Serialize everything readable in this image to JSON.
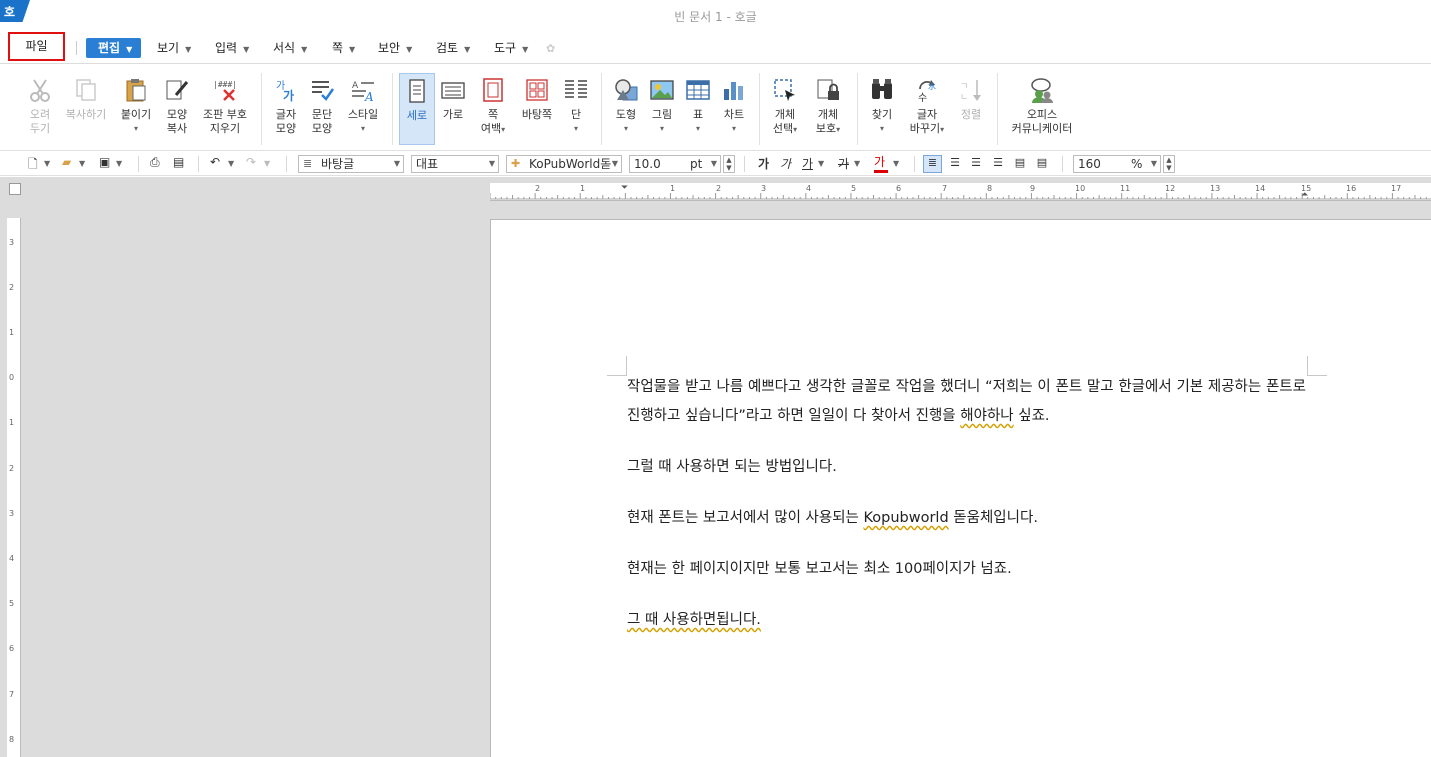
{
  "app": {
    "logo": "호",
    "title": "빈 문서 1 - 호글"
  },
  "menu": {
    "file": "파일",
    "items": [
      {
        "label": "편집"
      },
      {
        "label": "보기"
      },
      {
        "label": "입력"
      },
      {
        "label": "서식"
      },
      {
        "label": "쪽"
      },
      {
        "label": "보안"
      },
      {
        "label": "검토"
      },
      {
        "label": "도구"
      }
    ]
  },
  "ribbon": {
    "cut": [
      "오려",
      "두기"
    ],
    "copy": "복사하기",
    "paste": "붙이기",
    "format_copy": [
      "모양",
      "복사"
    ],
    "clear_codes": [
      "조판 부호",
      "지우기"
    ],
    "char_shape": [
      "글자",
      "모양"
    ],
    "para_shape": [
      "문단",
      "모양"
    ],
    "style": "스타일",
    "portrait": "세로",
    "landscape": "가로",
    "margins": [
      "쪽",
      "여백"
    ],
    "background": "바탕쪽",
    "columns": "단",
    "shapes": "도형",
    "picture": "그림",
    "table": "표",
    "chart": "차트",
    "obj_select": [
      "개체",
      "선택"
    ],
    "obj_protect": [
      "개체",
      "보호"
    ],
    "find": "찾기",
    "replace": [
      "글자",
      "바꾸기"
    ],
    "sort": "정렬",
    "community": [
      "오피스",
      "커뮤니케이터"
    ]
  },
  "formatbar": {
    "style": "바탕글",
    "lang": "대표",
    "font": "KoPubWorld돋",
    "size": "10.0",
    "unit": "pt",
    "bold": "가",
    "italic": "가",
    "underline": "가",
    "strike": "가",
    "color": "가",
    "zoom": "160",
    "zoom_unit": "%"
  },
  "document": {
    "p1": "작업물을 받고 나름 예쁘다고 생각한 글꼴로 작업을 했더니 “저희는 이 폰트 말고 한글에서 기본 제공하는 폰트로 진행하고 싶습니다”라고 하면 일일이 다 찾아서 진행을 ",
    "p1_tail": "해야하나",
    "p1_end": " 싶죠.",
    "p2": "그럴 때 사용하면 되는 방법입니다.",
    "p3_pre": "현재 폰트는 보고서에서 많이 사용되는 ",
    "p3_word": "Kopubworld",
    "p3_post": " 돋움체입니다.",
    "p4": "현재는 한 페이지이지만 보통 보고서는 최소 100페이지가 넘죠.",
    "p5": "그 때 사용하면됩니다."
  },
  "rulers": {
    "h": [
      "2",
      "1",
      "1",
      "2",
      "3",
      "4",
      "5",
      "6",
      "7",
      "8",
      "9",
      "10",
      "11",
      "12",
      "13",
      "14",
      "15",
      "16",
      "17"
    ],
    "v": [
      "3",
      "2",
      "1",
      "0",
      "1",
      "2",
      "3",
      "4",
      "5",
      "6",
      "7",
      "8"
    ]
  },
  "colors": {
    "accent": "#2a7fd4",
    "highlight": "#e01010"
  }
}
